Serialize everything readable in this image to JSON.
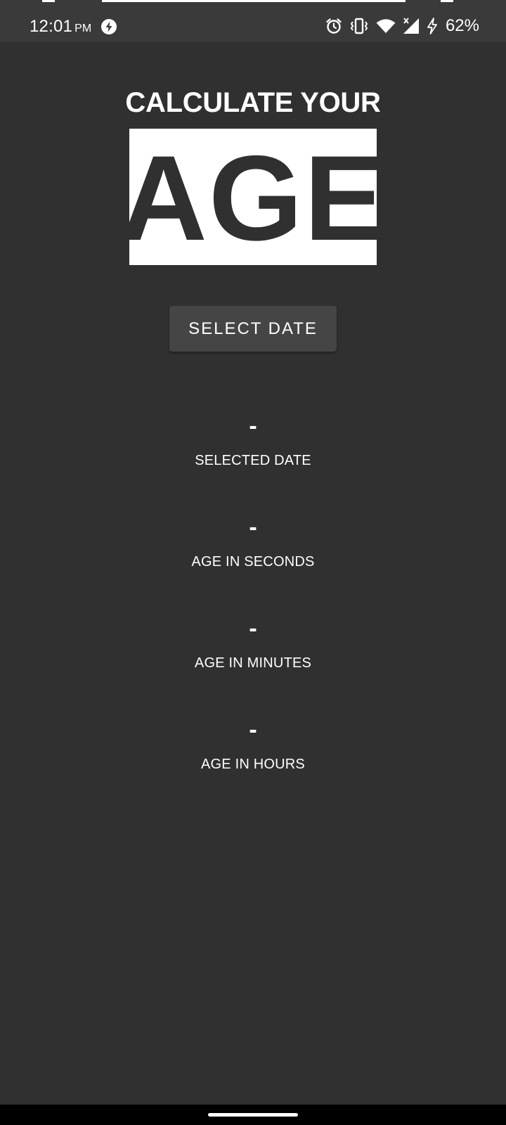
{
  "status_bar": {
    "time": "12:01",
    "ampm": "PM",
    "battery": "62%"
  },
  "main": {
    "heading": "CALCULATE YOUR",
    "logo_text": "AGE",
    "select_button_label": "SELECT DATE",
    "results": [
      {
        "value": "-",
        "label": "SELECTED DATE"
      },
      {
        "value": "-",
        "label": "AGE IN SECONDS"
      },
      {
        "value": "-",
        "label": "AGE IN MINUTES"
      },
      {
        "value": "-",
        "label": "AGE IN HOURS"
      }
    ]
  },
  "colors": {
    "background": "#303030",
    "status_bar": "#3a3a3a",
    "button": "#454545",
    "text": "#ffffff"
  },
  "icons": {
    "status_left": [
      "bolt-badge-icon"
    ],
    "status_right": [
      "alarm-icon",
      "vibrate-icon",
      "wifi-icon",
      "cell-signal-icon",
      "charging-icon"
    ]
  }
}
